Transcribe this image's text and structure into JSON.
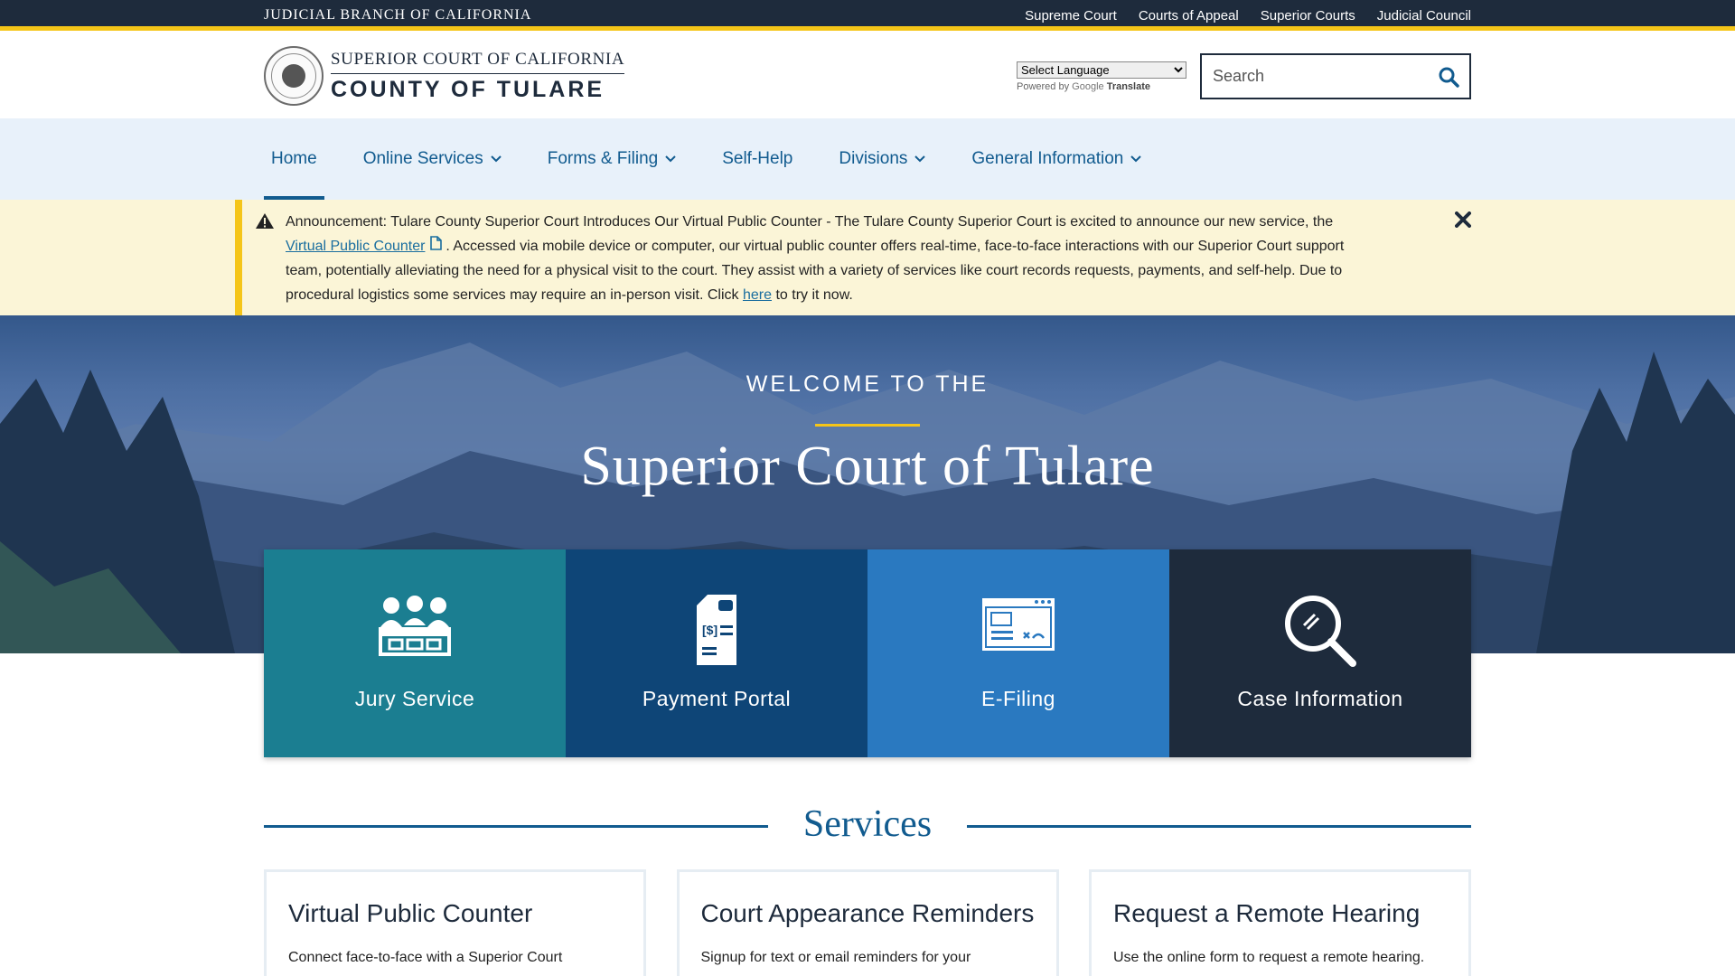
{
  "topbar": {
    "brand": "JUDICIAL BRANCH OF CALIFORNIA",
    "links": [
      "Supreme Court",
      "Courts of Appeal",
      "Superior Courts",
      "Judicial Council"
    ]
  },
  "header": {
    "logo_line1": "SUPERIOR COURT OF CALIFORNIA",
    "logo_line2": "COUNTY OF TULARE",
    "language_select": "Select Language",
    "powered_by": "Powered by",
    "google": "Google",
    "translate": "Translate",
    "search_placeholder": "Search"
  },
  "nav": {
    "items": [
      {
        "label": "Home",
        "dropdown": false
      },
      {
        "label": "Online Services",
        "dropdown": true
      },
      {
        "label": "Forms & Filing",
        "dropdown": true
      },
      {
        "label": "Self-Help",
        "dropdown": false
      },
      {
        "label": "Divisions",
        "dropdown": true
      },
      {
        "label": "General Information",
        "dropdown": true
      }
    ]
  },
  "announcement": {
    "part1": "Announcement: Tulare County Superior Court Introduces Our Virtual Public Counter - The Tulare County Superior Court is excited to announce our new service, the",
    "link1": "Virtual Public Counter",
    "part2": ".  Accessed via mobile device or computer, our virtual public counter offers real-time, face-to-face interactions with our Superior Court support team, potentially alleviating the need for a physical visit to the court. They assist with a variety of services like court records requests, payments, and self-help.  Due to procedural logistics some services may require an in-person visit.  Click",
    "link2": "here",
    "part3": "to try it now."
  },
  "hero": {
    "welcome": "WELCOME TO THE",
    "title": "Superior Court of Tulare"
  },
  "tiles": [
    {
      "label": "Jury Service",
      "icon": "jury-icon",
      "color": "#1b7e91"
    },
    {
      "label": "Payment Portal",
      "icon": "payment-document-icon",
      "color": "#0e4577"
    },
    {
      "label": "E-Filing",
      "icon": "e-filing-window-icon",
      "color": "#2a79c0"
    },
    {
      "label": "Case Information",
      "icon": "magnifier-icon",
      "color": "#1e2b3c"
    }
  ],
  "services": {
    "heading": "Services",
    "cards": [
      {
        "title": "Virtual Public Counter",
        "desc": "Connect face-to-face with a Superior Court"
      },
      {
        "title": "Court Appearance Reminders",
        "desc": "Signup for text or email reminders for your"
      },
      {
        "title": "Request a Remote Hearing",
        "desc": "Use the online form to request a remote hearing."
      }
    ]
  },
  "colors": {
    "navy": "#1e2b3c",
    "accent_yellow": "#f5c518",
    "link_blue": "#115b8f",
    "nav_bg": "#e8f1fa",
    "announce_bg": "#fbf5d7"
  }
}
